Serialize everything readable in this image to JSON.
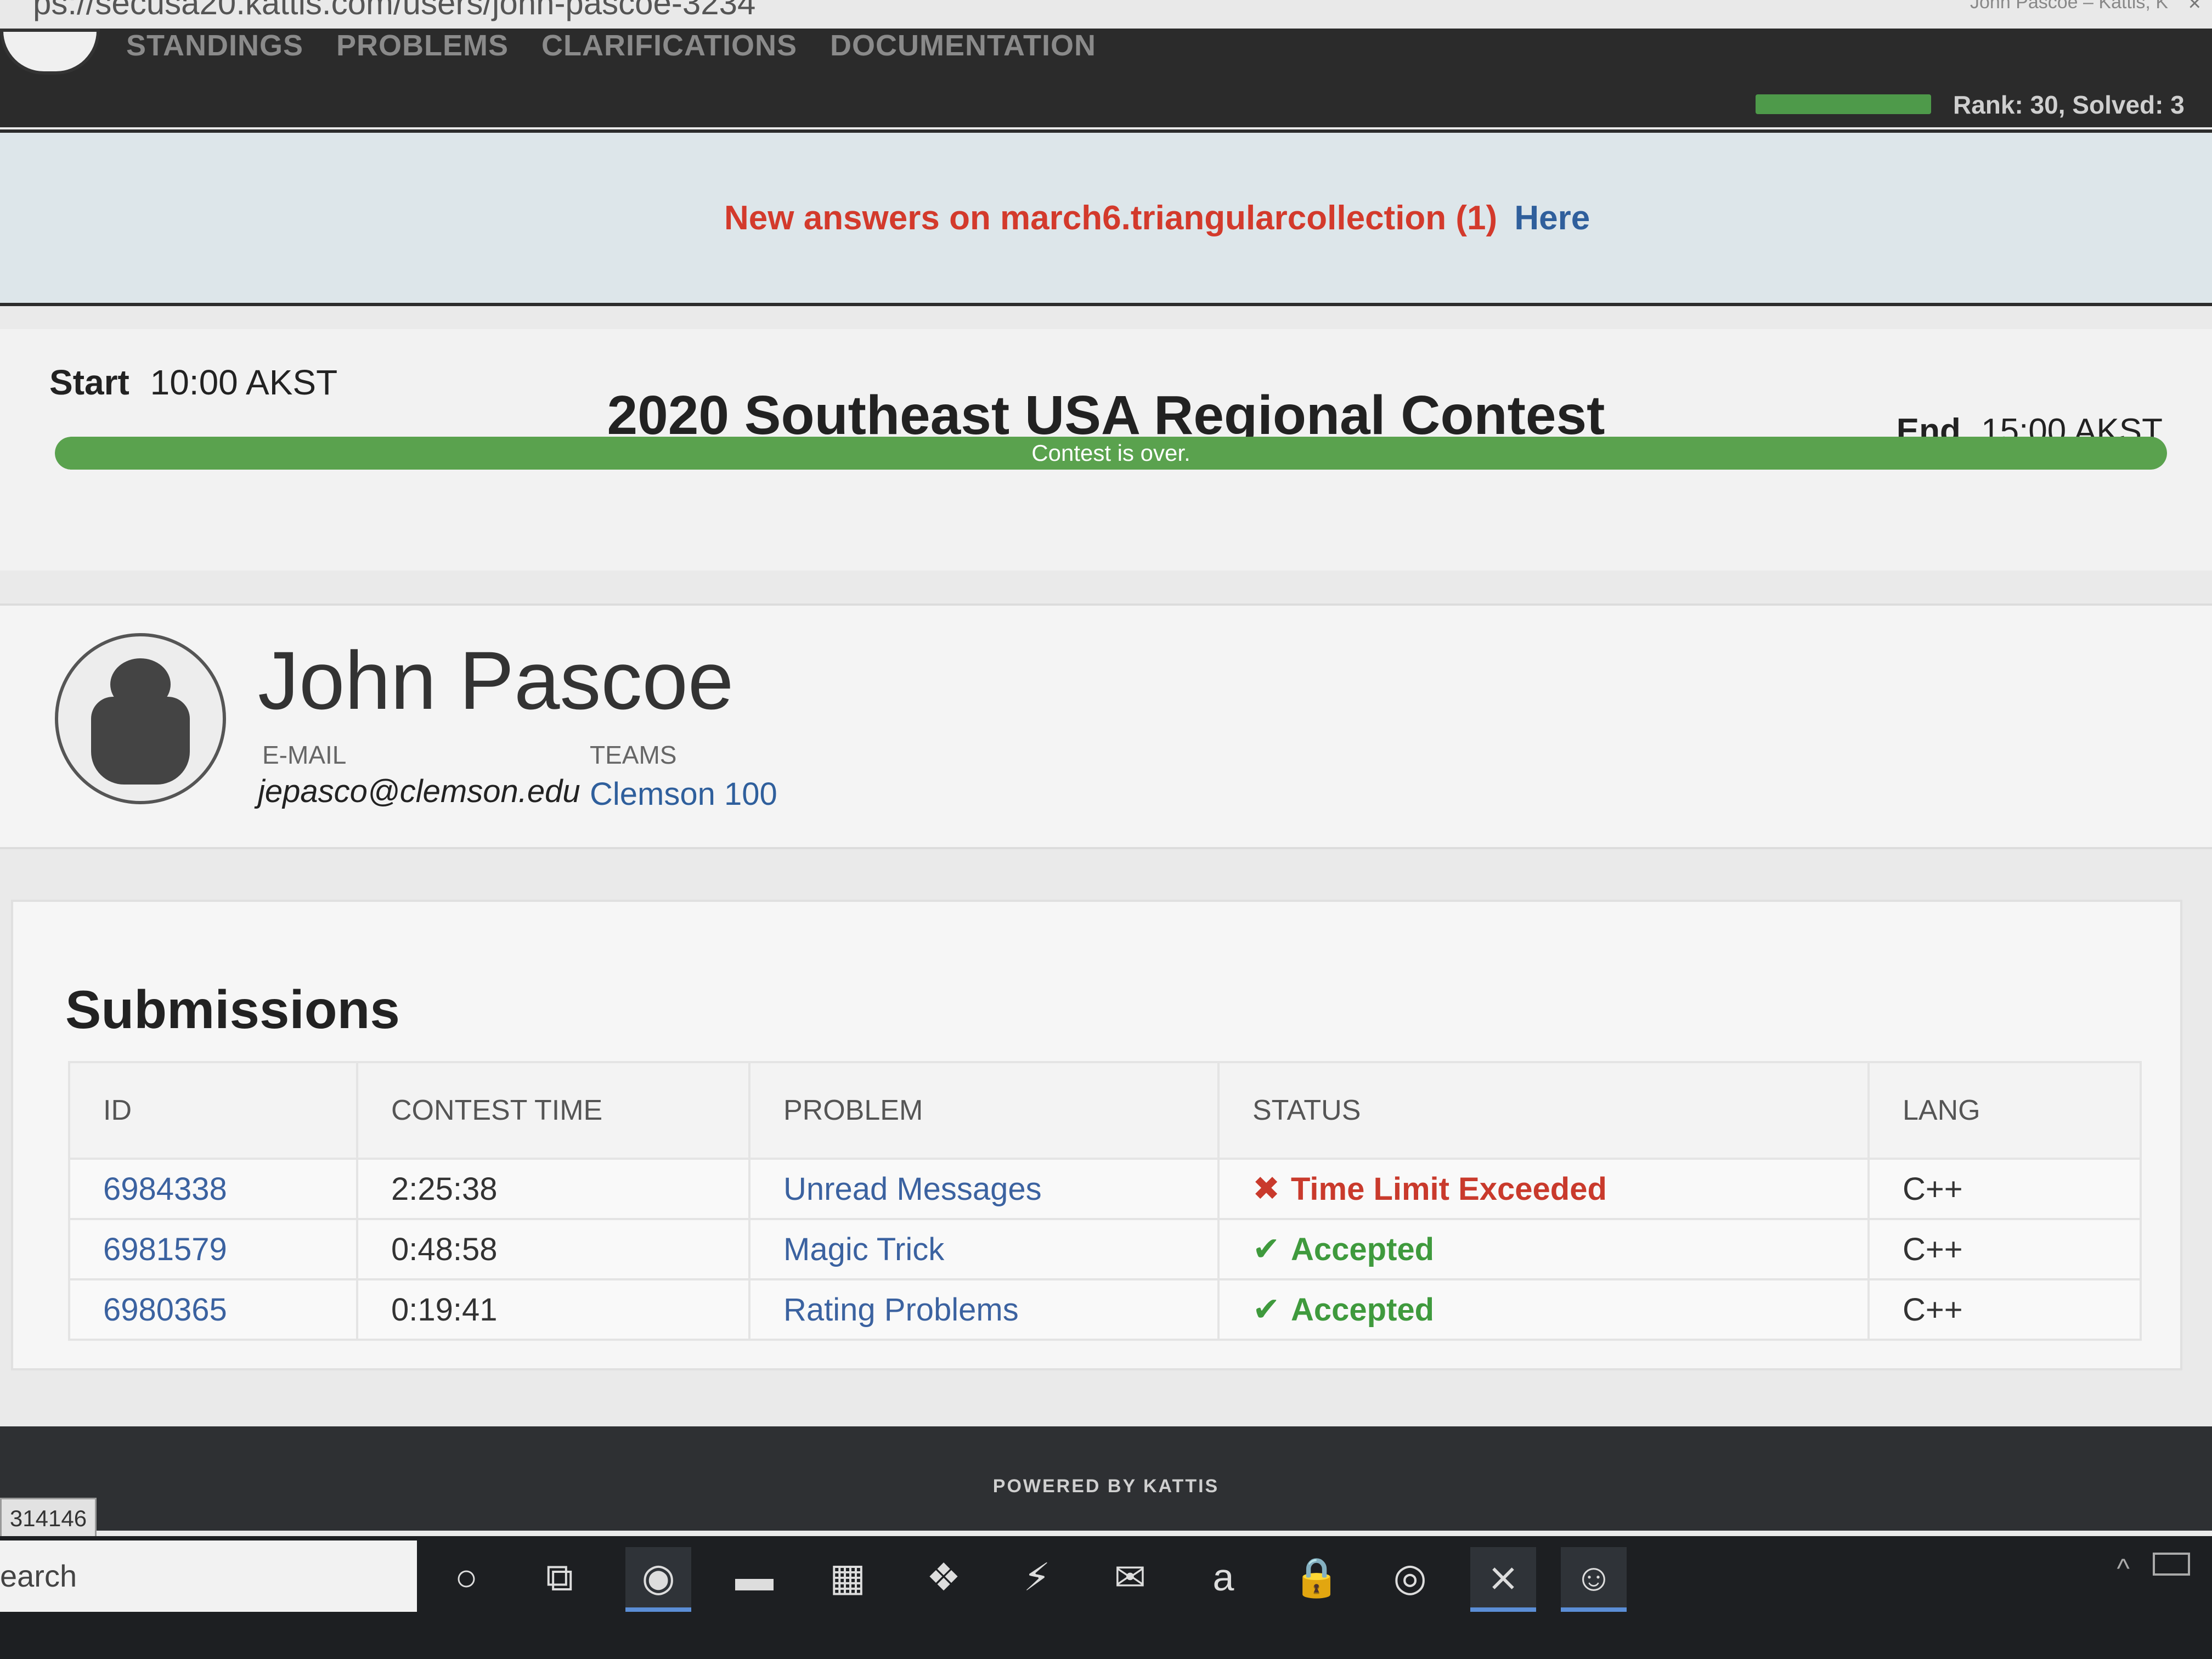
{
  "browser": {
    "url": "ps://secusa20.kattis.com/users/john-pascoe-3234",
    "tab_title": "John Pascoe – Kattis, K",
    "close": "×"
  },
  "navbar": {
    "links": [
      "STANDINGS",
      "PROBLEMS",
      "CLARIFICATIONS",
      "DOCUMENTATION"
    ],
    "rank_text": "Rank: 30, Solved: 3"
  },
  "banner": {
    "message": "New answers on march6.triangularcollection (1)",
    "link": "Here"
  },
  "contest": {
    "start_label": "Start",
    "start_time": "10:00 AKST",
    "title": "2020 Southeast USA Regional Contest",
    "end_label": "End",
    "end_time": "15:00 AKST",
    "progress": 1.0,
    "status": "Contest is over."
  },
  "profile": {
    "name": "John Pascoe",
    "email_label": "E-MAIL",
    "email": "jepasco@clemson.edu",
    "teams_label": "TEAMS",
    "team": "Clemson 100"
  },
  "submissions": {
    "heading": "Submissions",
    "columns": [
      "ID",
      "CONTEST TIME",
      "PROBLEM",
      "STATUS",
      "LANG"
    ],
    "rows": [
      {
        "id": "6984338",
        "time": "2:25:38",
        "problem": "Unread Messages",
        "status": "Time Limit Exceeded",
        "status_icon": "✖",
        "ok": false,
        "lang": "C++"
      },
      {
        "id": "6981579",
        "time": "0:48:58",
        "problem": "Magic Trick",
        "status": "Accepted",
        "status_icon": "✔",
        "ok": true,
        "lang": "C++"
      },
      {
        "id": "6980365",
        "time": "0:19:41",
        "problem": "Rating Problems",
        "status": "Accepted",
        "status_icon": "✔",
        "ok": true,
        "lang": "C++"
      }
    ]
  },
  "footer": {
    "powered": "POWERED BY KATTIS",
    "counter": "314146"
  },
  "taskbar": {
    "search_text": "earch",
    "icons": [
      "cortana-icon",
      "task-view-icon",
      "edge-icon",
      "file-explorer-icon",
      "store-icon",
      "dropbox-icon",
      "visual-studio-icon",
      "mail-icon",
      "amazon-icon",
      "lock-app-icon",
      "chrome-icon",
      "vscode-icon",
      "discord-icon"
    ],
    "icon_glyphs": [
      "○",
      "⧉",
      "◉",
      "▬",
      "▦",
      "❖",
      "⚡",
      "✉",
      "a",
      "🔒",
      "◎",
      "⨯",
      "☺"
    ],
    "tray_up": "^"
  },
  "colors": {
    "error_red": "#c93a2c",
    "accepted_green": "#3f9a3d",
    "link_blue": "#2f5f9c",
    "progress_green": "#5aa24e"
  }
}
